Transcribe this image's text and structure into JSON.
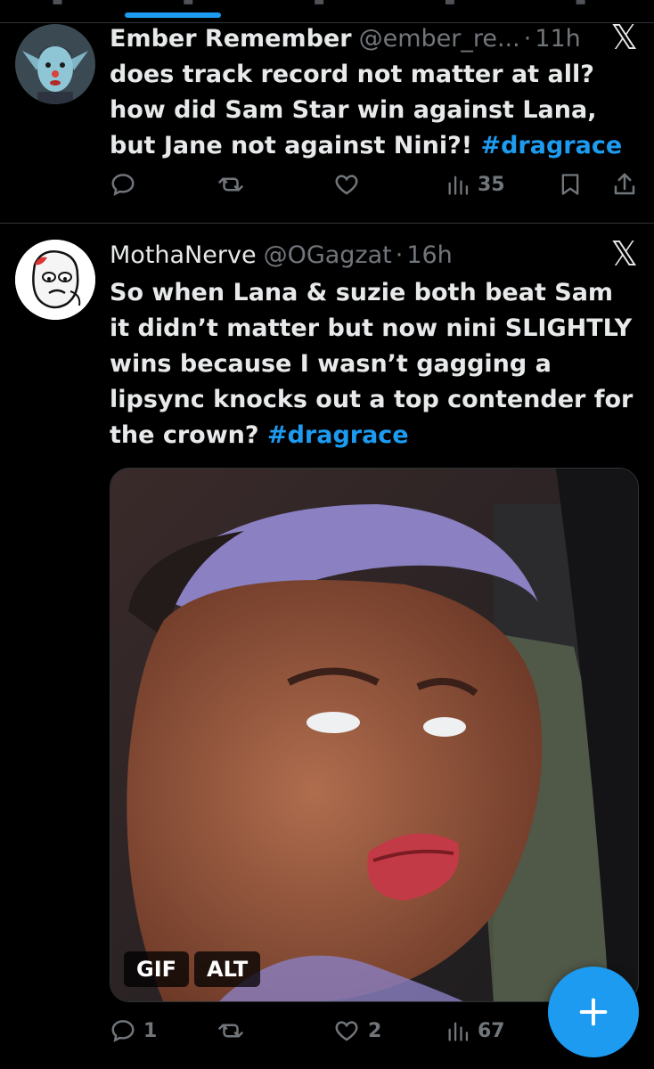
{
  "colors": {
    "background": "#000000",
    "text": "#e7e9ea",
    "muted": "#71767b",
    "accent": "#1d9bf0",
    "divider": "#2f3336"
  },
  "posts": [
    {
      "display_name": "Ember Remember",
      "handle": "@ember_re...",
      "separator": "·",
      "time": "11h",
      "close_icon": "x-logo-icon",
      "text": "does track record not matter at all? how did Sam Star win against Lana, but Jane not against Nini?!",
      "hashtag": "#dragrace",
      "stats": {
        "replies": "",
        "reposts": "",
        "likes": "",
        "views": "35"
      },
      "icons": [
        "reply-icon",
        "repost-icon",
        "like-icon",
        "views-icon",
        "bookmark-icon",
        "share-icon"
      ]
    },
    {
      "display_name": "MothaNerve",
      "handle": "@OGagzat",
      "separator": "·",
      "time": "16h",
      "close_icon": "x-logo-icon",
      "text": "So when Lana & suzie both beat Sam it didn’t matter but now nini SLIGHTLY wins because I wasn’t gagging a lipsync knocks out a top contender for the crown?",
      "hashtag": "#dragrace",
      "media": {
        "badges": [
          "GIF",
          "ALT"
        ]
      },
      "stats": {
        "replies": "1",
        "reposts": "",
        "likes": "2",
        "views": "67"
      },
      "icons": [
        "reply-icon",
        "repost-icon",
        "like-icon",
        "views-icon"
      ]
    }
  ],
  "compose_button": {
    "label": "+",
    "icon": "plus-icon"
  }
}
